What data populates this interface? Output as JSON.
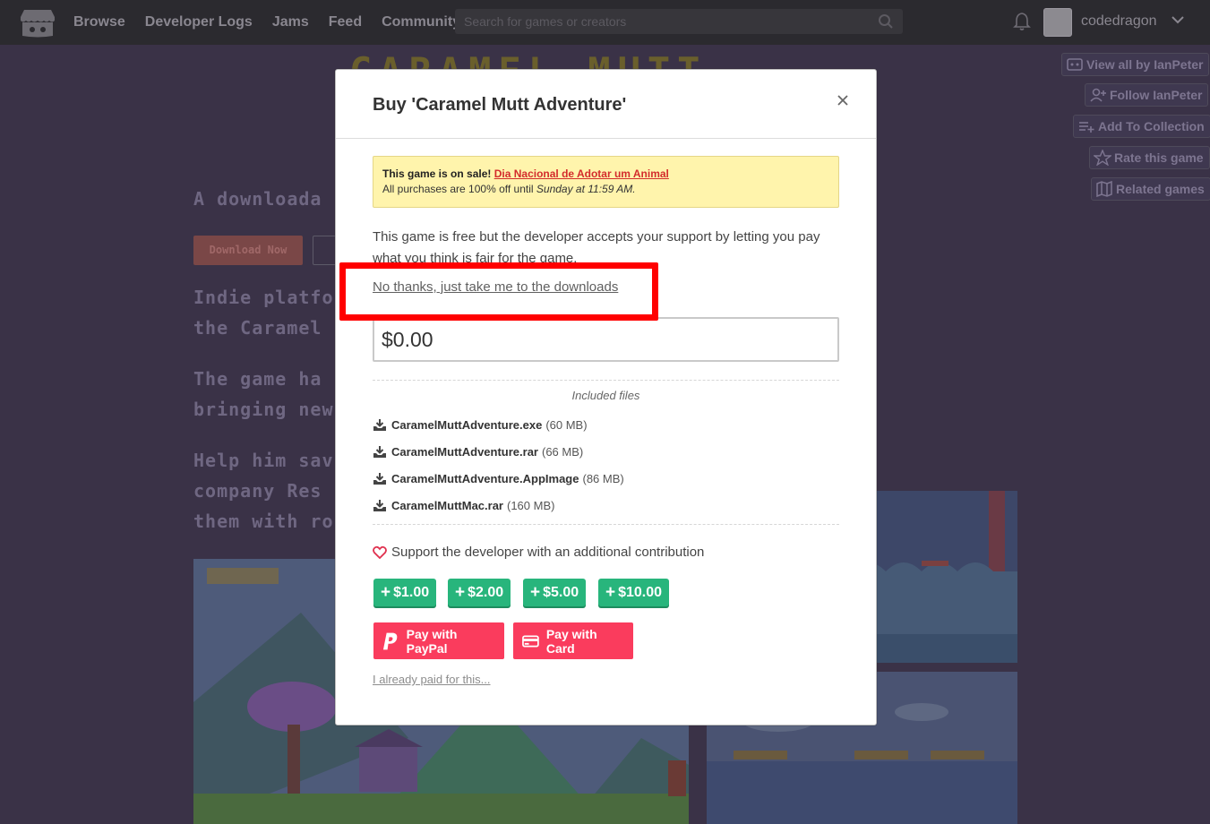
{
  "nav": {
    "links": [
      "Browse",
      "Developer Logs",
      "Jams",
      "Feed",
      "Community"
    ],
    "search_placeholder": "Search for games or creators",
    "username": "codedragon",
    "avatar_label": "Codedragon"
  },
  "background": {
    "title": "CARAMEL MUTT",
    "tagline": "A downloada",
    "download_label": "Download Now",
    "para1_line1": "Indie platfor",
    "para1_line2": "the Caramel",
    "para2_line1": "The game ha",
    "para2_line2": "bringing new",
    "para3_line1": "Help him sav",
    "para3_line2": "company Res",
    "para3_line3": "them with ro",
    "side_buttons": [
      "View all by IanPeter",
      "Follow IanPeter",
      "Add To Collection",
      "Rate this game",
      "Related games"
    ]
  },
  "modal": {
    "title": "Buy 'Caramel Mutt Adventure'",
    "sale_prefix": "This game is on sale!",
    "sale_link": "Dia Nacional de Adotar um Animal",
    "sale_detail": "All purchases are 100% off until",
    "sale_until": "Sunday at 11:59 AM.",
    "intro": "This game is free but the developer accepts your support by letting you pay what you think is fair for the game.",
    "no_thanks": "No thanks, just take me to the downloads",
    "price_value": "$0.00",
    "files_label": "Included files",
    "files": [
      {
        "name": "CaramelMuttAdventure.exe",
        "size": "(60 MB)"
      },
      {
        "name": "CaramelMuttAdventure.rar",
        "size": "(66 MB)"
      },
      {
        "name": "CaramelMuttAdventure.AppImage",
        "size": "(86 MB)"
      },
      {
        "name": "CaramelMuttMac.rar",
        "size": "(160 MB)"
      }
    ],
    "support_text": "Support the developer with an additional contribution",
    "tips": [
      "$1.00",
      "$2.00",
      "$5.00",
      "$10.00"
    ],
    "pay_paypal": "Pay with PayPal",
    "pay_card": "Pay with Card",
    "already_paid": "I already paid for this..."
  },
  "colors": {
    "nav_bg": "#2b2a2f",
    "page_bg": "#3a3247",
    "tip_green": "#28b57c",
    "pay_red": "#fa3c5d",
    "sale_yellow": "#fff4ac",
    "highlight": "#ff0000"
  }
}
